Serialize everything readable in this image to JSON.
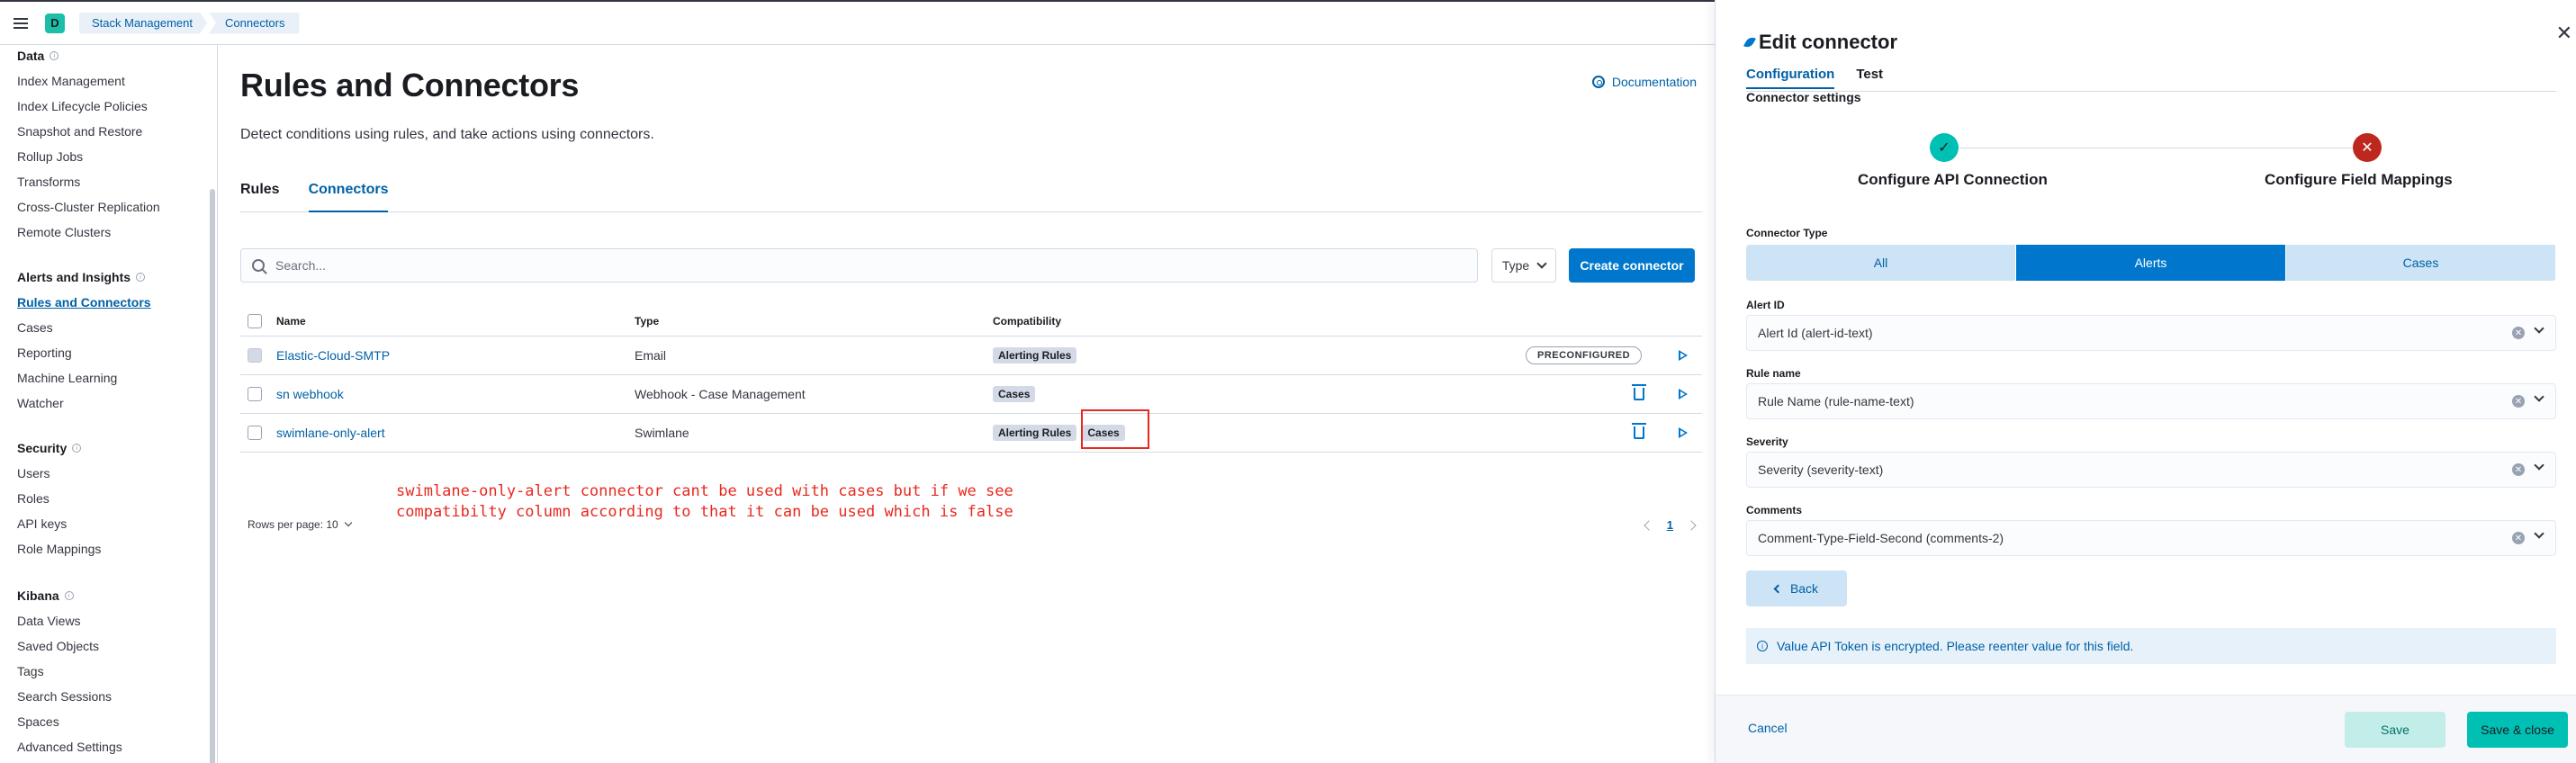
{
  "header": {
    "space_initial": "D",
    "breadcrumbs": [
      "Stack Management",
      "Connectors"
    ]
  },
  "sidebar": {
    "groups": [
      {
        "title": "Data",
        "items": [
          "Index Management",
          "Index Lifecycle Policies",
          "Snapshot and Restore",
          "Rollup Jobs",
          "Transforms",
          "Cross-Cluster Replication",
          "Remote Clusters"
        ]
      },
      {
        "title": "Alerts and Insights",
        "items": [
          "Rules and Connectors",
          "Cases",
          "Reporting",
          "Machine Learning",
          "Watcher"
        ]
      },
      {
        "title": "Security",
        "items": [
          "Users",
          "Roles",
          "API keys",
          "Role Mappings"
        ]
      },
      {
        "title": "Kibana",
        "items": [
          "Data Views",
          "Saved Objects",
          "Tags",
          "Search Sessions",
          "Spaces",
          "Advanced Settings"
        ]
      }
    ]
  },
  "main": {
    "title": "Rules and Connectors",
    "doc_link": "Documentation",
    "description": "Detect conditions using rules, and take actions using connectors.",
    "tabs": [
      "Rules",
      "Connectors"
    ],
    "search_placeholder": "Search...",
    "type_filter": "Type",
    "create_button": "Create connector",
    "table": {
      "headers": [
        "Name",
        "Type",
        "Compatibility"
      ],
      "rows": [
        {
          "name": "Elastic-Cloud-SMTP",
          "type": "Email",
          "compat": [
            "Alerting Rules"
          ],
          "tag": "PRECONFIGURED"
        },
        {
          "name": "sn webhook",
          "type": "Webhook - Case Management",
          "compat": [
            "Cases"
          ]
        },
        {
          "name": "swimlane-only-alert",
          "type": "Swimlane",
          "compat": [
            "Alerting Rules",
            "Cases"
          ]
        }
      ]
    },
    "rows_per_page": "Rows per page: 10",
    "current_page": "1",
    "annotation": "swimlane-only-alert connector cant be used with cases but if we see compatibilty column according to that it can be used which is false"
  },
  "flyout": {
    "title": "Edit connector",
    "tabs": [
      "Configuration",
      "Test"
    ],
    "section_label": "Connector settings",
    "steps": [
      "Configure API Connection",
      "Configure Field Mappings"
    ],
    "connector_type_label": "Connector Type",
    "connector_types": [
      "All",
      "Alerts",
      "Cases"
    ],
    "fields": [
      {
        "label": "Alert ID",
        "value": "Alert Id (alert-id-text)"
      },
      {
        "label": "Rule name",
        "value": "Rule Name (rule-name-text)"
      },
      {
        "label": "Severity",
        "value": "Severity (severity-text)"
      },
      {
        "label": "Comments",
        "value": "Comment-Type-Field-Second (comments-2)"
      }
    ],
    "back_button": "Back",
    "callout": "Value API Token is encrypted. Please reenter value for this field.",
    "cancel": "Cancel",
    "save": "Save",
    "save_close": "Save & close"
  }
}
